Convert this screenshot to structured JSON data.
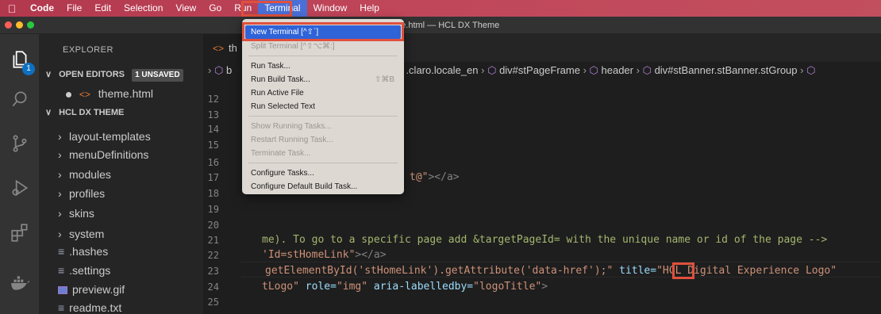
{
  "menubar": {
    "app": "Code",
    "items": [
      "File",
      "Edit",
      "Selection",
      "View",
      "Go",
      "Run",
      "Terminal",
      "Window",
      "Help"
    ],
    "active": "Terminal"
  },
  "window": {
    "title": "theme.html — HCL DX Theme"
  },
  "activity": {
    "explorer_badge": "1"
  },
  "sidebar": {
    "title": "EXPLORER",
    "open_editors_label": "OPEN EDITORS",
    "unsaved_label": "1 UNSAVED",
    "open_file": "theme.html",
    "project_label": "HCL DX THEME",
    "folders": [
      "layout-templates",
      "menuDefinitions",
      "modules",
      "profiles",
      "skins",
      "system"
    ],
    "files": [
      ".hashes",
      ".settings",
      "preview.gif",
      "readme.txt"
    ]
  },
  "editor": {
    "tab_label": "th",
    "breadcrumb_start": "b",
    "breadcrumb_tail": ".claro.locale_en",
    "breadcrumb_items": [
      "div#stPageFrame",
      "header",
      "div#stBanner.stBanner.stGroup"
    ],
    "line_numbers": [
      "12",
      "13",
      "14",
      "15",
      "16",
      "17",
      "18",
      "19",
      "20",
      "21",
      "22",
      "23",
      "24",
      "25"
    ],
    "lines": {
      "l17_str": "t@\"",
      "l17_tag": "></a>",
      "l21_comment": "me). To go to a specific page add &targetPageId= with the unique name or id of the page -->",
      "l22_str": "'Id=stHomeLink\"",
      "l22_tag": "></a>",
      "l23_text": "getElementById('stHomeLink').getAttribute('data-href');\"",
      "l23_attr": "title=",
      "l23_quote": "\"",
      "l23_hcl": "HCL",
      "l23_rest": " Digital Experience Logo\"",
      "l24_str": "tLogo\"",
      "l24_attr1": "role=",
      "l24_val1": "\"img\"",
      "l24_attr2": "aria-labelledby=",
      "l24_val2": "\"logoTitle\"",
      "l24_tag": ">"
    }
  },
  "terminal_menu": {
    "items": [
      {
        "label": "New Terminal [^⇧`]",
        "state": "selected"
      },
      {
        "label": "Split Terminal [^⇧⌥⌘:]",
        "state": "disabled"
      },
      {
        "label": "Run Task...",
        "state": "normal"
      },
      {
        "label": "Run Build Task...",
        "state": "normal",
        "shortcut": "⇧⌘B"
      },
      {
        "label": "Run Active File",
        "state": "normal"
      },
      {
        "label": "Run Selected Text",
        "state": "normal"
      },
      {
        "label": "Show Running Tasks...",
        "state": "disabled"
      },
      {
        "label": "Restart Running Task...",
        "state": "disabled"
      },
      {
        "label": "Terminate Task...",
        "state": "disabled"
      },
      {
        "label": "Configure Tasks...",
        "state": "normal"
      },
      {
        "label": "Configure Default Build Task...",
        "state": "normal"
      }
    ]
  },
  "colors": {
    "highlight_box": "#e0503c",
    "menu_selected": "#2f63d8",
    "comment": "#a4b66f",
    "string": "#ce9178",
    "attribute": "#9cdcfe"
  }
}
